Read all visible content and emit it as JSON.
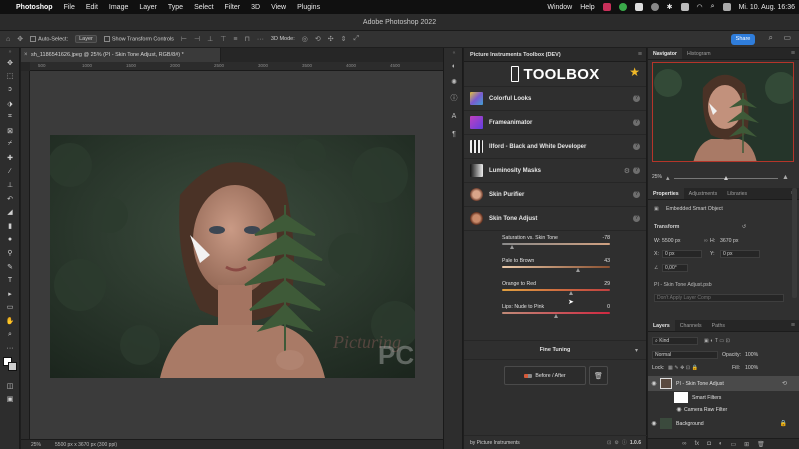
{
  "menubar": {
    "app": "Photoshop",
    "items": [
      "File",
      "Edit",
      "Image",
      "Layer",
      "Type",
      "Select",
      "Filter",
      "3D",
      "View",
      "Plugins"
    ],
    "right_items": [
      "Window",
      "Help"
    ],
    "clock": "Mi. 10. Aug.  16:36"
  },
  "window": {
    "title": "Adobe Photoshop 2022"
  },
  "optionsbar": {
    "auto_select": "Auto-Select:",
    "auto_select_value": "Layer",
    "show_transform": "Show Transform Controls",
    "mode_3d": "3D Mode:",
    "share": "Share"
  },
  "document": {
    "tab": "sh_1186541626.jpeg @ 25% (PI - Skin Tone Adjust, RGB/8#) *",
    "close": "×",
    "ruler_ticks": [
      "500",
      "1000",
      "1500",
      "2000",
      "2500",
      "3000",
      "3500",
      "4000",
      "4500"
    ],
    "watermark": "PC",
    "watermark_script": "Picturing",
    "status_zoom": "25%",
    "status_size": "5500 px x 3670 px (300 ppi)"
  },
  "toolbox": {
    "panel_title": "Picture Instruments Toolbox (DEV)",
    "brand": "TOOLBOX",
    "items": [
      {
        "label": "Colorful Looks",
        "help": "?"
      },
      {
        "label": "Frameanimator",
        "help": "?"
      },
      {
        "label": "Ilford - Black and White Developer",
        "help": "?"
      },
      {
        "label": "Luminosity Masks",
        "help": "?"
      },
      {
        "label": "Skin Purifier",
        "help": "?"
      },
      {
        "label": "Skin Tone Adjust",
        "help": "?"
      }
    ],
    "sliders": [
      {
        "label": "Saturation vs. Skin Tone",
        "value": "-78",
        "pos": 0.1
      },
      {
        "label": "Pale to Brown",
        "value": "43",
        "pos": 0.71
      },
      {
        "label": "Orange to Red",
        "value": "29",
        "pos": 0.64
      },
      {
        "label": "Lips: Nude to Pink",
        "value": "0",
        "pos": 0.5
      }
    ],
    "fine_tuning": "Fine Tuning",
    "before_after": "Before / After",
    "footer_by": "by Picture Instruments",
    "version": "1.0.6"
  },
  "navigator": {
    "tabs": [
      "Navigator",
      "Histogram"
    ],
    "zoom": "25%",
    "zoom_pos": 0.5
  },
  "properties": {
    "tabs": [
      "Properties",
      "Adjustments",
      "Libraries"
    ],
    "smart_object": "Embedded Smart Object",
    "transform": "Transform",
    "w_label": "W:",
    "w_value": "5500 px",
    "h_label": "H:",
    "h_value": "3670 px",
    "x_label": "X:",
    "x_value": "0 px",
    "y_label": "Y:",
    "y_value": "0 px",
    "angle": "0,00°",
    "file": "PI - Skin Tone Adjust.psb",
    "dont_apply": "Don't Apply Layer Comp"
  },
  "layers": {
    "tabs": [
      "Layers",
      "Channels",
      "Paths"
    ],
    "kind": "Kind",
    "blend": "Normal",
    "opacity_label": "Opacity:",
    "opacity": "100%",
    "lock_label": "Lock:",
    "fill_label": "Fill:",
    "fill": "100%",
    "items": [
      {
        "name": "PI - Skin Tone Adjust"
      },
      {
        "name": "Smart Filters"
      },
      {
        "name": "Camera Raw Filter"
      },
      {
        "name": "Background"
      }
    ]
  },
  "colors": {
    "accent": "#2f7ddb",
    "star": "#f0b828",
    "slider_saturation": "#9a9a9a",
    "slider_pale_brown": "#c48a55",
    "slider_orange_red": "#d86a3a",
    "slider_lips": "#c8404a"
  }
}
